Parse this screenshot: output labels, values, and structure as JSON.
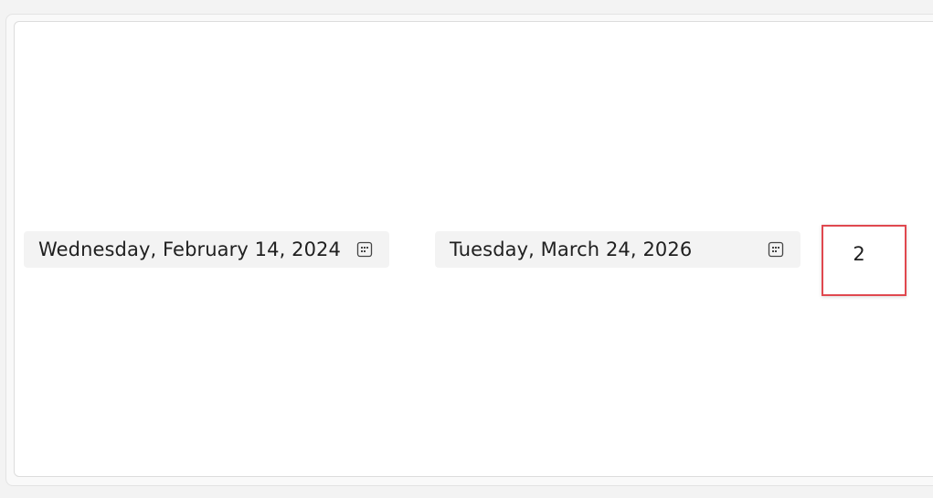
{
  "start_date": {
    "display": "Wednesday, February 14, 2024",
    "icon": "calendar-icon"
  },
  "end_date": {
    "display": "Tuesday, March 24, 2026",
    "icon": "calendar-icon"
  },
  "result": {
    "value": "2",
    "highlight_color": "#e0484f"
  }
}
